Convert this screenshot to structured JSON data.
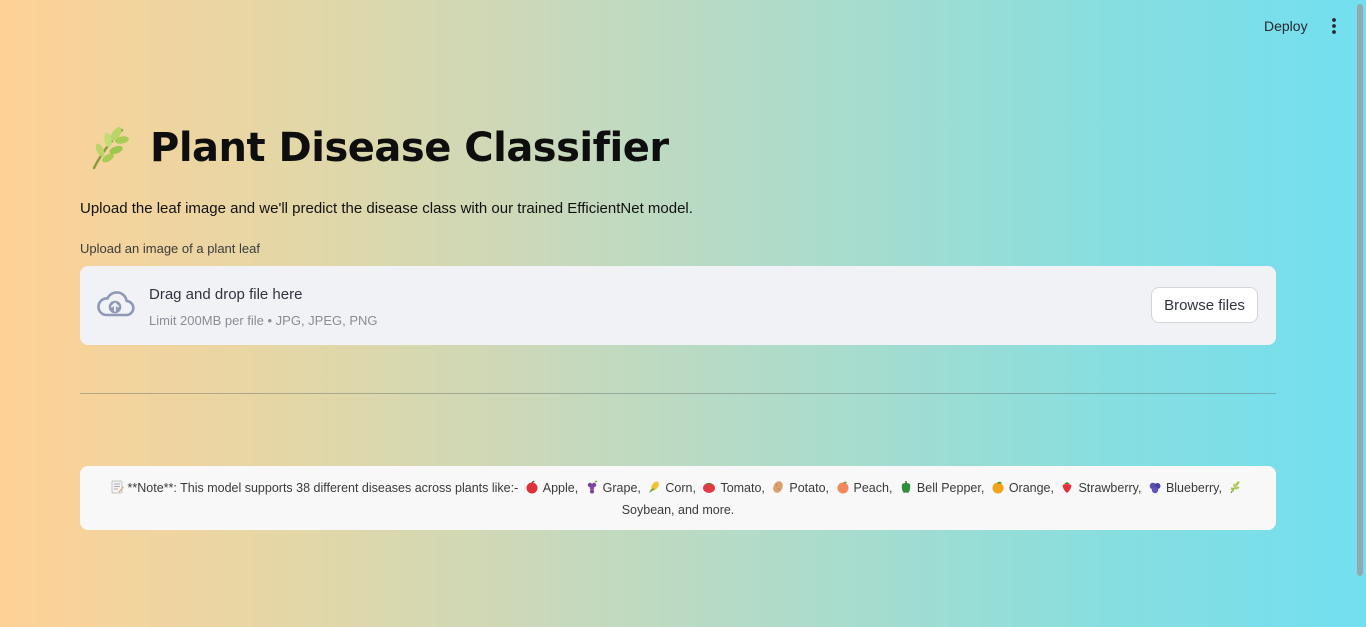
{
  "header": {
    "deploy_label": "Deploy",
    "menu_icon": "vertical-ellipsis-icon"
  },
  "main": {
    "title_icon": "herb-icon",
    "title": "Plant Disease Classifier",
    "subtitle": "Upload the leaf image and we'll predict the disease class with our trained EfficientNet model.",
    "uploader": {
      "label": "Upload an image of a plant leaf",
      "icon": "cloud-upload-icon",
      "drag_text": "Drag and drop file here",
      "limit_text": "Limit 200MB per file • JPG, JPEG, PNG",
      "browse_label": "Browse files"
    },
    "note": {
      "icon": "memo-icon",
      "intro": "**Note**: This model supports 38 different diseases across plants like:-",
      "plants": [
        {
          "icon": "apple-icon",
          "label": "Apple,"
        },
        {
          "icon": "grape-icon",
          "label": "Grape,"
        },
        {
          "icon": "corn-icon",
          "label": "Corn,"
        },
        {
          "icon": "tomato-icon",
          "label": "Tomato,"
        },
        {
          "icon": "potato-icon",
          "label": "Potato,"
        },
        {
          "icon": "peach-icon",
          "label": "Peach,"
        },
        {
          "icon": "bell-pepper-icon",
          "label": "Bell Pepper,"
        },
        {
          "icon": "orange-icon",
          "label": "Orange,"
        },
        {
          "icon": "strawberry-icon",
          "label": "Strawberry,"
        },
        {
          "icon": "blueberry-icon",
          "label": "Blueberry,"
        },
        {
          "icon": "herb-icon",
          "label": "Soybean, and more."
        }
      ]
    }
  },
  "colors": {
    "gradient_left": "#fed196",
    "gradient_right": "#72dff0",
    "dropzone_bg": "#f0f2f6",
    "note_bg": "#f8f8f9"
  }
}
